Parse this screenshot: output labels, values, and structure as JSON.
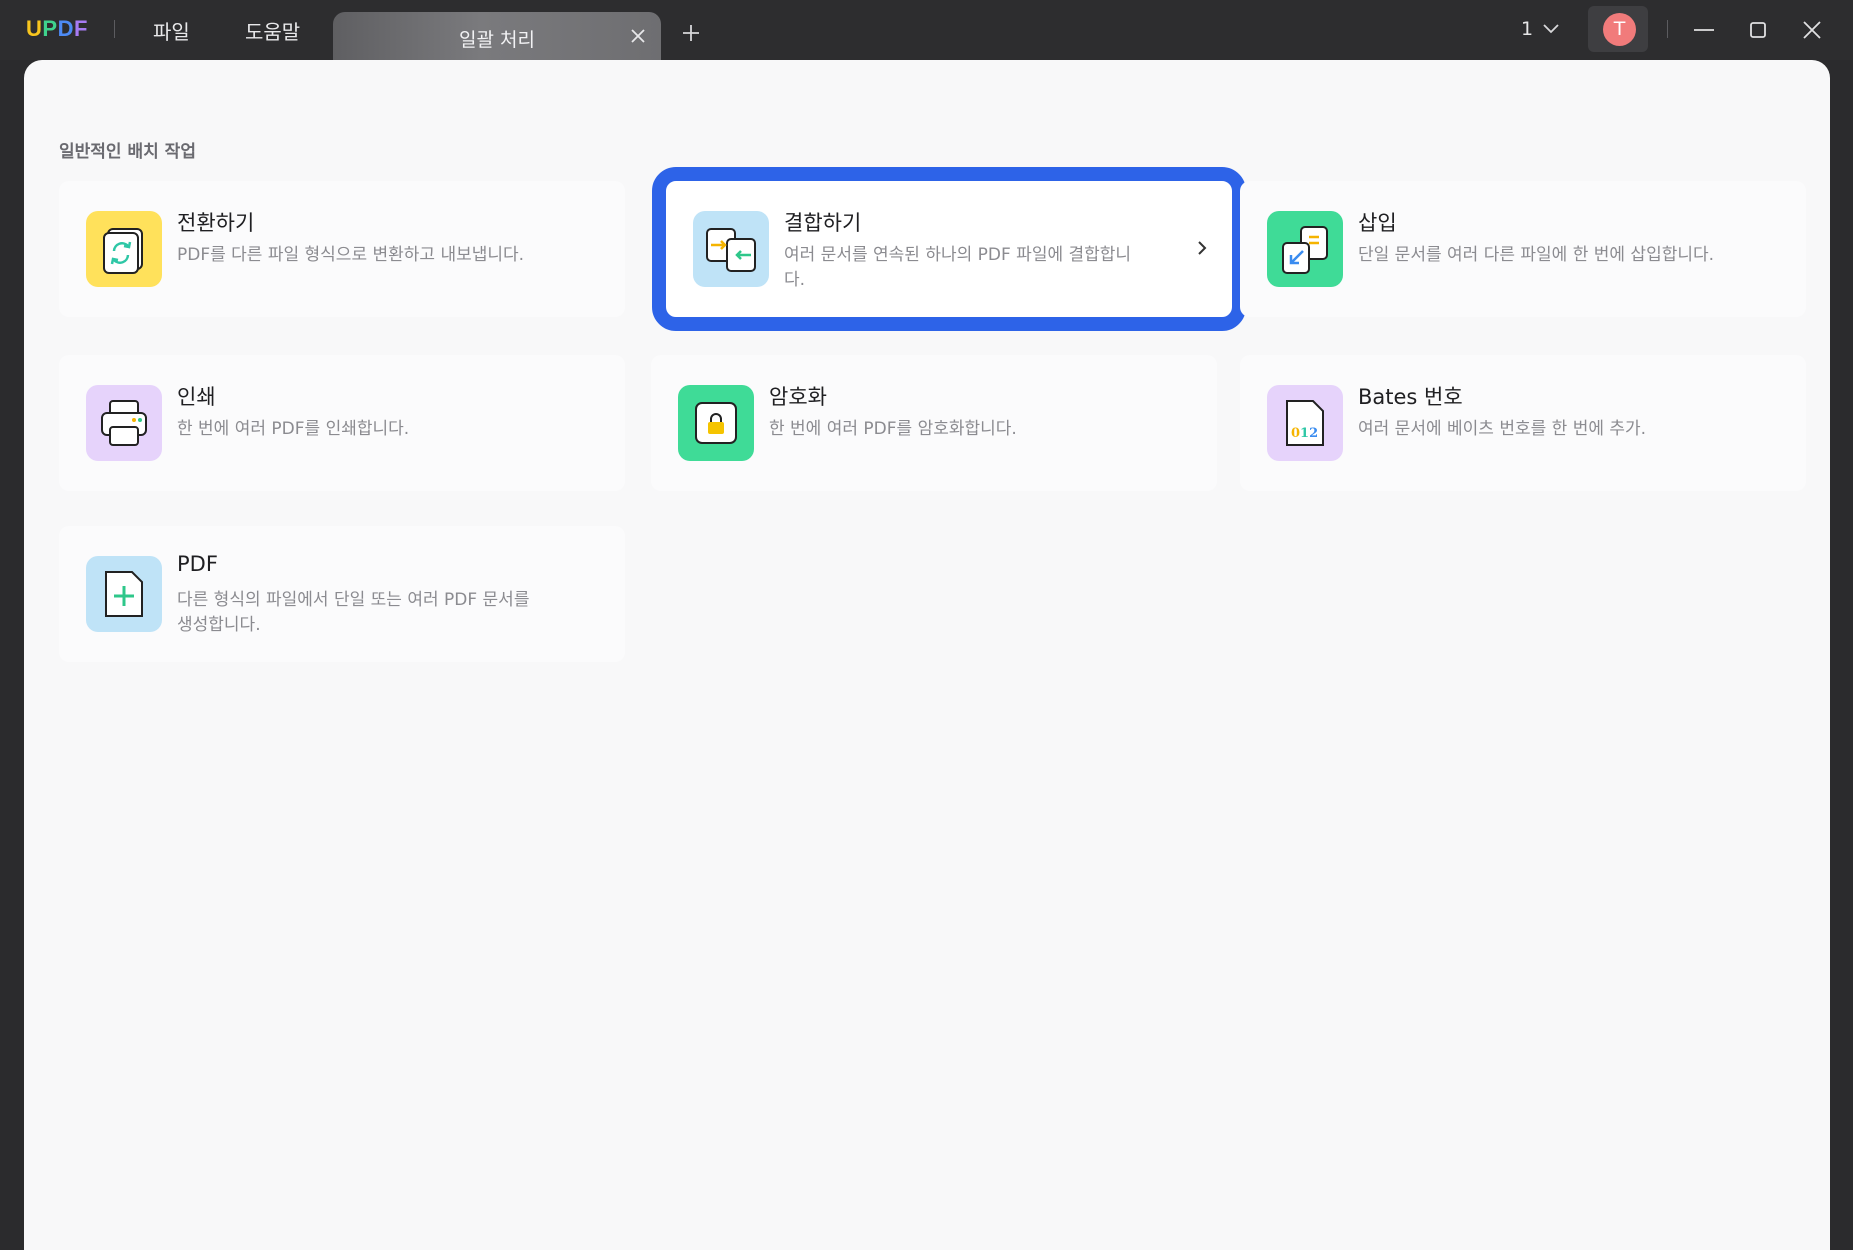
{
  "titlebar": {
    "logo": [
      "U",
      "P",
      "D",
      "F"
    ],
    "menu": {
      "file": "파일",
      "help": "도움말"
    },
    "tab": {
      "label": "일괄 처리",
      "close_icon": "close-icon"
    },
    "add_tab_icon": "plus-icon",
    "page_selector": "1",
    "avatar_initial": "T",
    "window_controls": [
      "minimize-icon",
      "maximize-icon",
      "close-icon"
    ]
  },
  "main": {
    "section_title": "일반적인 배치 작업",
    "cards": [
      {
        "title": "전환하기",
        "desc": "PDF를 다른 파일 형식으로 변환하고 내보냅니다.",
        "icon": "convert-icon",
        "color": "#ffe15b"
      },
      {
        "title": "결합하기",
        "desc": "여러 문서를 연속된 하나의 PDF 파일에 결합합니다.",
        "icon": "combine-icon",
        "color": "#bfe3f7",
        "selected": true
      },
      {
        "title": "삽입",
        "desc": "단일 문서를 여러 다른 파일에 한 번에 삽입합니다.",
        "icon": "insert-icon",
        "color": "#3fdb97"
      },
      {
        "title": "인쇄",
        "desc": "한 번에 여러 PDF를 인쇄합니다.",
        "icon": "printer-icon",
        "color": "#e6d3fb"
      },
      {
        "title": "암호화",
        "desc": "한 번에 여러 PDF를 암호화합니다.",
        "icon": "lock-icon",
        "color": "#3fdb97"
      },
      {
        "title": "Bates 번호",
        "desc": "여러 문서에 베이츠 번호를 한 번에 추가.",
        "icon": "bates-number-icon",
        "color": "#e6d3fb"
      },
      {
        "title": "PDF",
        "desc": "다른 형식의 파일에서 단일 또는 여러 PDF 문서를 생성합니다.",
        "icon": "create-pdf-icon",
        "color": "#bfe3f7"
      }
    ],
    "accent_color": "#2d63e8"
  }
}
